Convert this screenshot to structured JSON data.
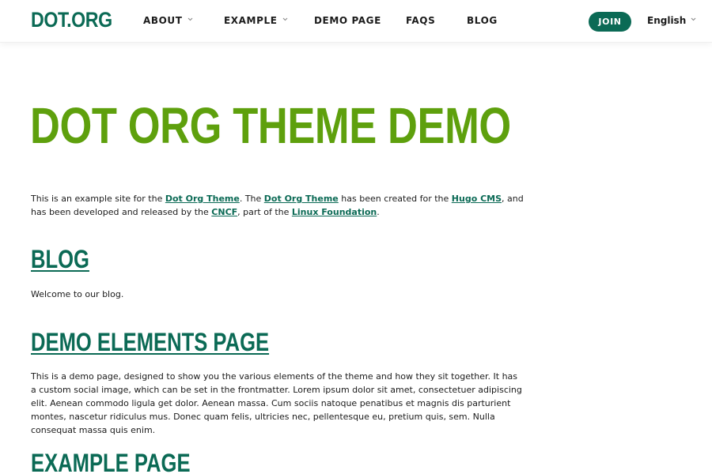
{
  "header": {
    "logo": "DOT.ORG",
    "nav": [
      {
        "label": "ABOUT"
      },
      {
        "label": "EXAMPLE"
      },
      {
        "label": "DEMO PAGE"
      },
      {
        "label": "FAQS"
      },
      {
        "label": "BLOG"
      }
    ],
    "join_label": "JOIN",
    "language": "English"
  },
  "hero": {
    "title": "DOT ORG THEME DEMO"
  },
  "intro": {
    "t1": "This is an example site for the ",
    "link1": "Dot Org Theme",
    "t2": ". The ",
    "link2": "Dot Org Theme",
    "t3": " has been created for the ",
    "link3": "Hugo CMS",
    "t4": ", and has been developed and released by the ",
    "link4": "CNCF",
    "t5": ", part of the ",
    "link5": "Linux Foundation",
    "t6": "."
  },
  "sections": [
    {
      "heading": "BLOG",
      "body": "Welcome to our blog."
    },
    {
      "heading": "DEMO ELEMENTS PAGE",
      "body": "This is a demo page, designed to show you the various elements of the theme and how they sit together. It has a custom social image, which can be set in the frontmatter. Lorem ipsum dolor sit amet, consectetuer adipiscing elit. Aenean commodo ligula get dolor. Aenean massa. Cum sociis natoque penatibus et magnis dis parturient montes, nascetur ridiculus mus. Donec quam felis, ultricies nec, pellentesque eu, pretium quis, sem. Nulla consequat massa quis enim."
    },
    {
      "heading": "EXAMPLE PAGE"
    }
  ],
  "colors": {
    "brand": "#0b6a55",
    "hero": "#5ea00d"
  }
}
